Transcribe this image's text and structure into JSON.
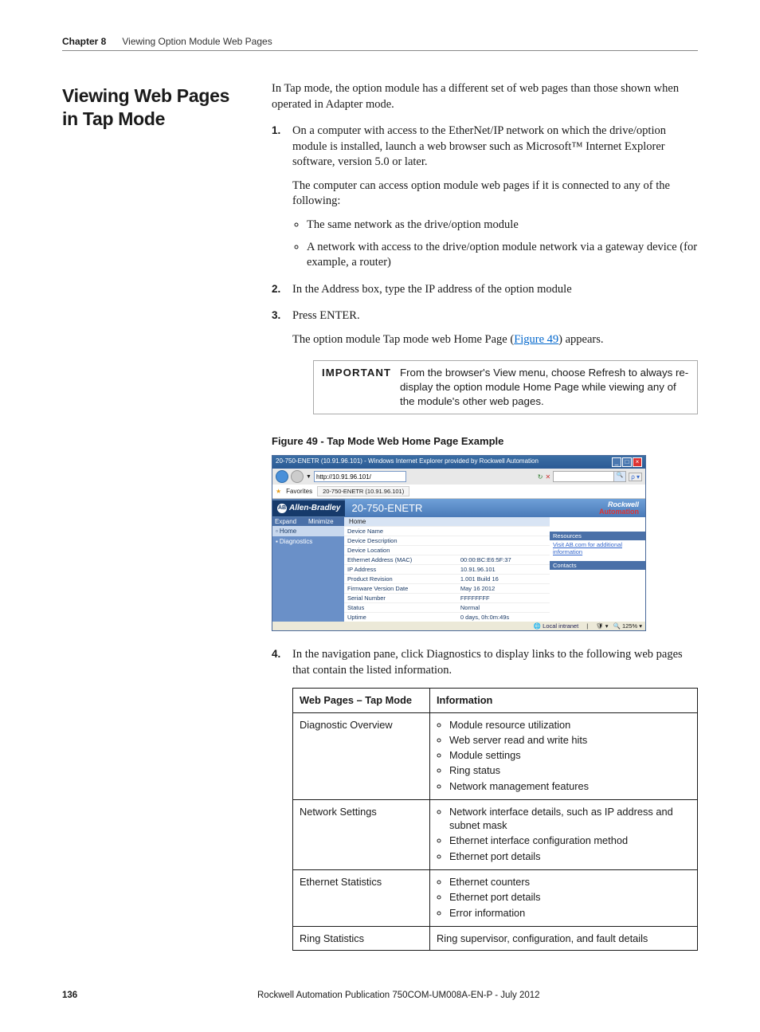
{
  "header": {
    "chapter": "Chapter 8",
    "title": "Viewing Option Module Web Pages"
  },
  "section_heading": "Viewing Web Pages in Tap Mode",
  "intro": "In Tap mode, the option module has a different set of web pages than those shown when operated in Adapter mode.",
  "steps": {
    "s1": {
      "num": "1.",
      "p1": "On a computer with access to the EtherNet/IP network on which the drive/option module is installed, launch a web browser such as Microsoft™ Internet Explorer software, version 5.0 or later.",
      "p2": "The computer can access option module web pages if it is connected to any of the following:",
      "b1": "The same network as the drive/option module",
      "b2": "A network with access to the drive/option module network via a gateway device (for example, a router)"
    },
    "s2": {
      "num": "2.",
      "text": "In the Address box, type the IP address of the option module"
    },
    "s3": {
      "num": "3.",
      "text": "Press ENTER.",
      "after_pre": "The option module Tap mode web Home Page (",
      "link": "Figure 49",
      "after_post": ") appears."
    },
    "s4": {
      "num": "4.",
      "text": "In the navigation pane, click Diagnostics to display links to the following web pages that contain the listed information."
    }
  },
  "important": {
    "label": "IMPORTANT",
    "text": "From the browser's View menu, choose Refresh to always re-display the option module Home Page while viewing any of the module's other web pages."
  },
  "figure_caption": "Figure 49 - Tap Mode Web Home Page Example",
  "ie": {
    "title": "20-750-ENETR (10.91.96.101) - Windows Internet Explorer provided by Rockwell Automation",
    "url": "http://10.91.96.101/",
    "fav_label": "Favorites",
    "tab_label": "20-750-ENETR (10.91.96.101)",
    "brand_ab": "Allen-Bradley",
    "device_name": "20-750-ENETR",
    "brand_r1": "Rockwell",
    "brand_r2": "Automation",
    "nav": {
      "expand": "Expand",
      "minimize": "Minimize",
      "home": "Home",
      "diag": "Diagnostics"
    },
    "crumb": "Home",
    "rows": [
      {
        "k": "Device Name",
        "v": ""
      },
      {
        "k": "Device Description",
        "v": ""
      },
      {
        "k": "Device Location",
        "v": ""
      },
      {
        "k": "Ethernet Address (MAC)",
        "v": "00:00:BC:E6:5F:37"
      },
      {
        "k": "IP Address",
        "v": "10.91.96.101"
      },
      {
        "k": "Product Revision",
        "v": "1.001 Build 16"
      },
      {
        "k": "Firmware Version Date",
        "v": "May 16 2012"
      },
      {
        "k": "Serial Number",
        "v": "FFFFFFFF"
      },
      {
        "k": "Status",
        "v": "Normal"
      },
      {
        "k": "Uptime",
        "v": "0 days, 0h:0m:49s"
      }
    ],
    "side": {
      "resources": "Resources",
      "link": "Visit AB.com for additional information",
      "contacts": "Contacts"
    },
    "status": {
      "zone": "Local intranet",
      "zoom": "125%"
    }
  },
  "info_table": {
    "h1": "Web Pages – Tap Mode",
    "h2": "Information",
    "rows": [
      {
        "c1": "Diagnostic Overview",
        "items": [
          "Module resource utilization",
          "Web server read and write hits",
          "Module settings",
          "Ring status",
          "Network management features"
        ]
      },
      {
        "c1": "Network Settings",
        "items": [
          "Network interface details, such as IP address and subnet mask",
          "Ethernet interface configuration method",
          "Ethernet port details"
        ]
      },
      {
        "c1": "Ethernet Statistics",
        "items": [
          "Ethernet counters",
          "Ethernet port details",
          "Error information"
        ]
      },
      {
        "c1": "Ring Statistics",
        "text": "Ring supervisor, configuration, and fault details"
      }
    ]
  },
  "footer": {
    "page": "136",
    "pub": "Rockwell Automation Publication 750COM-UM008A-EN-P - July 2012"
  }
}
